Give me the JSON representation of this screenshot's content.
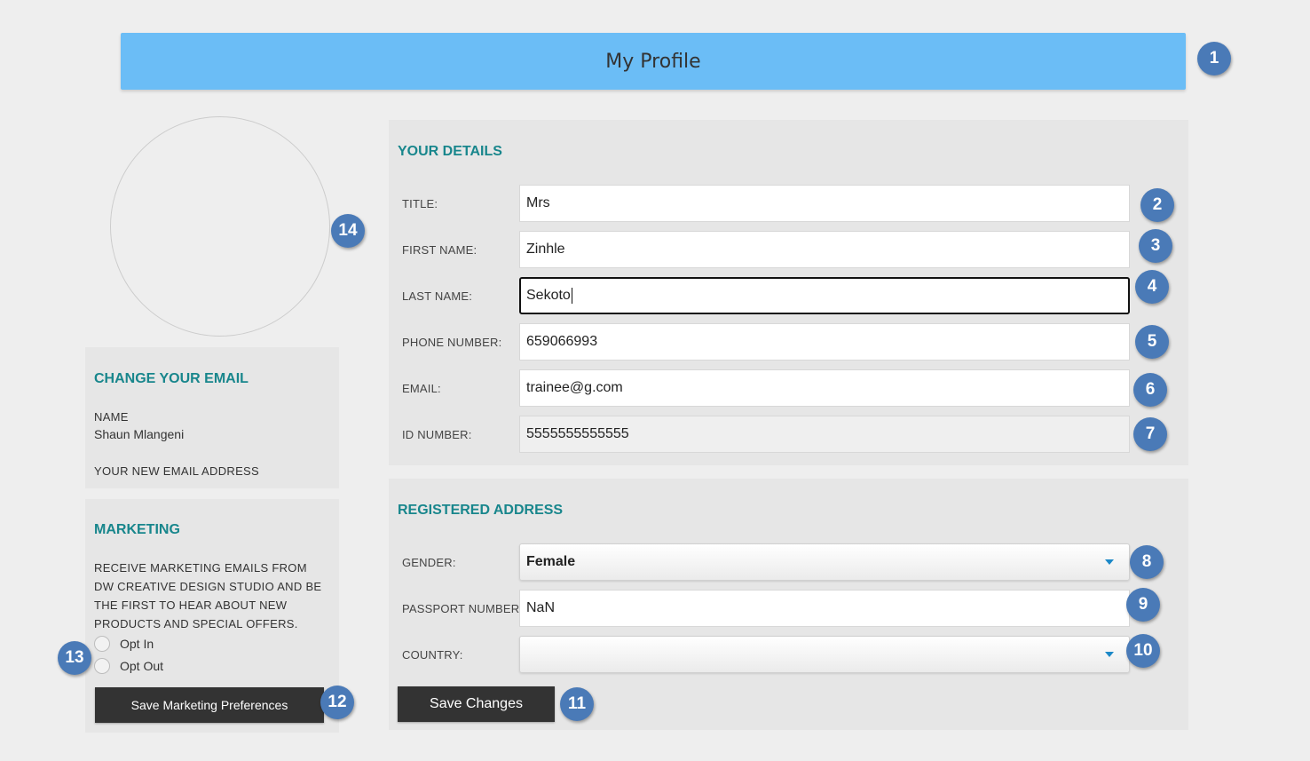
{
  "header": {
    "title": "My Profile"
  },
  "details": {
    "heading": "YOUR DETAILS",
    "title_label": "TITLE:",
    "title_value": "Mrs",
    "first_name_label": "FIRST NAME:",
    "first_name_value": "Zinhle",
    "last_name_label": "LAST NAME:",
    "last_name_value": "Sekoto",
    "phone_label": "PHONE NUMBER:",
    "phone_value": "659066993",
    "email_label": "EMAIL:",
    "email_value": "trainee@g.com",
    "id_label": "ID NUMBER:",
    "id_value": "5555555555555"
  },
  "address": {
    "heading": "REGISTERED ADDRESS",
    "gender_label": "GENDER:",
    "gender_value": "Female",
    "passport_label": "PASSPORT NUMBER",
    "passport_value": "NaN",
    "country_label": "COUNTRY:",
    "country_value": "",
    "save_label": "Save Changes"
  },
  "change_email": {
    "heading": "CHANGE YOUR EMAIL",
    "name_label": "NAME",
    "name_value": "Shaun Mlangeni",
    "new_email_label": "YOUR NEW EMAIL ADDRESS"
  },
  "marketing": {
    "heading": "MARKETING",
    "description": "RECEIVE MARKETING EMAILS FROM DW CREATIVE DESIGN STUDIO AND BE THE FIRST TO HEAR ABOUT NEW PRODUCTS AND SPECIAL OFFERS.",
    "opt_in_label": "Opt In",
    "opt_out_label": "Opt Out",
    "save_label": "Save Marketing Preferences"
  },
  "badges": {
    "b1": "1",
    "b2": "2",
    "b3": "3",
    "b4": "4",
    "b5": "5",
    "b6": "6",
    "b7": "7",
    "b8": "8",
    "b9": "9",
    "b10": "10",
    "b11": "11",
    "b12": "12",
    "b13": "13",
    "b14": "14"
  },
  "colors": {
    "header_bg": "#6bbdf6",
    "heading_teal": "#18868c",
    "badge_blue": "#4a7ab7",
    "button_dark": "#333333",
    "page_bg": "#eeeeee",
    "panel_bg": "#e6e6e6"
  },
  "icons": {
    "select_arrow": "chevron-down-icon",
    "avatar": "avatar-placeholder"
  }
}
